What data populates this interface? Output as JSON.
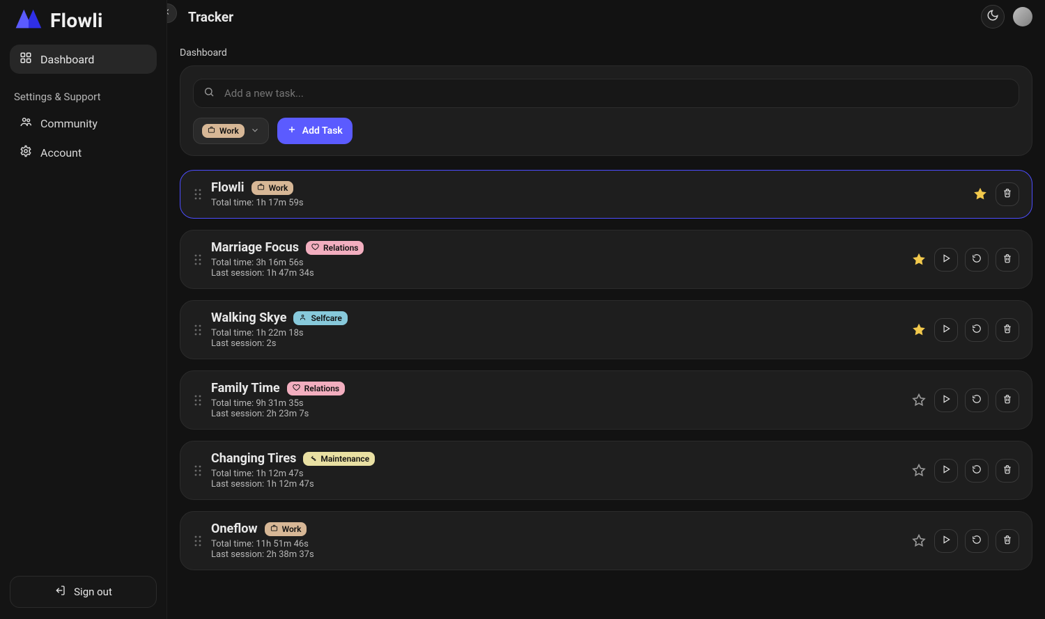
{
  "brand": {
    "name": "Flowli"
  },
  "topbar": {
    "title": "Tracker"
  },
  "page": {
    "label": "Dashboard"
  },
  "sidebar": {
    "nav": {
      "dashboard": "Dashboard"
    },
    "section_title": "Settings & Support",
    "links": {
      "community": "Community",
      "account": "Account"
    },
    "signout": "Sign out"
  },
  "composer": {
    "search_placeholder": "Add a new task...",
    "tag_label": "Work",
    "add_label": "Add Task"
  },
  "tags": {
    "work": "Work",
    "relations": "Relations",
    "selfcare": "Selfcare",
    "maintenance": "Maintenance"
  },
  "tasks": [
    {
      "id": "flowli",
      "title": "Flowli",
      "tag": "work",
      "total_label": "Total time: 1h 17m 59s",
      "last_label": "",
      "starred": true,
      "highlight": true,
      "show_play": false,
      "show_reset": false,
      "show_delete": true
    },
    {
      "id": "marriage-focus",
      "title": "Marriage Focus",
      "tag": "relations",
      "total_label": "Total time: 3h 16m 56s",
      "last_label": "Last session: 1h 47m 34s",
      "starred": true,
      "highlight": false,
      "show_play": true,
      "show_reset": true,
      "show_delete": true
    },
    {
      "id": "walking-skye",
      "title": "Walking Skye",
      "tag": "selfcare",
      "total_label": "Total time: 1h 22m 18s",
      "last_label": "Last session: 2s",
      "starred": true,
      "highlight": false,
      "show_play": true,
      "show_reset": true,
      "show_delete": true
    },
    {
      "id": "family-time",
      "title": "Family Time",
      "tag": "relations",
      "total_label": "Total time: 9h 31m 35s",
      "last_label": "Last session: 2h 23m 7s",
      "starred": false,
      "highlight": false,
      "show_play": true,
      "show_reset": true,
      "show_delete": true
    },
    {
      "id": "changing-tires",
      "title": "Changing Tires",
      "tag": "maintenance",
      "total_label": "Total time: 1h 12m 47s",
      "last_label": "Last session: 1h 12m 47s",
      "starred": false,
      "highlight": false,
      "show_play": true,
      "show_reset": true,
      "show_delete": true
    },
    {
      "id": "oneflow",
      "title": "Oneflow",
      "tag": "work",
      "total_label": "Total time: 11h 51m 46s",
      "last_label": "Last session: 2h 38m 37s",
      "starred": false,
      "highlight": false,
      "show_play": true,
      "show_reset": true,
      "show_delete": true
    }
  ]
}
